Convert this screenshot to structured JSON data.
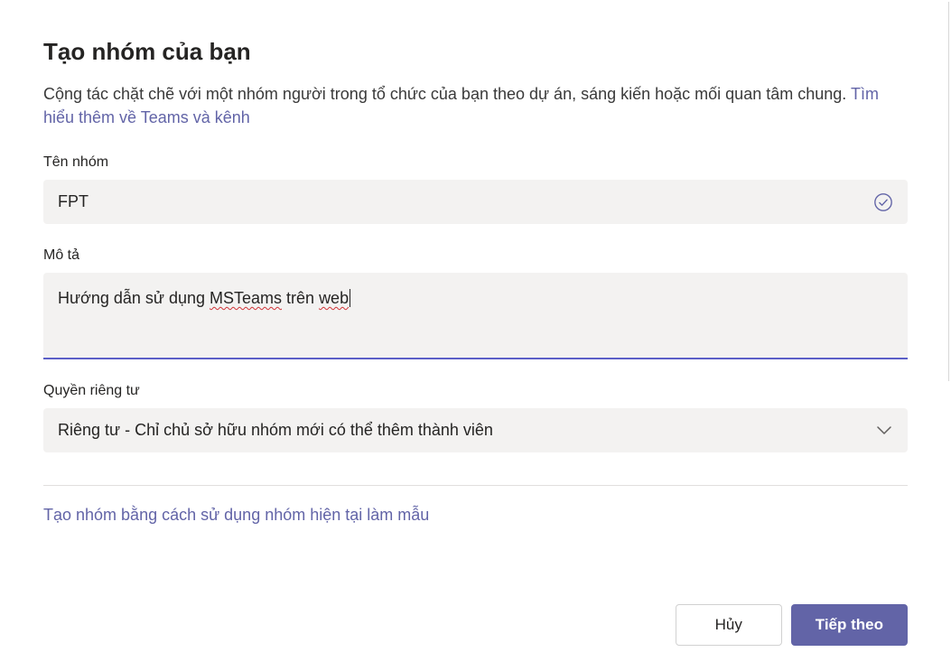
{
  "dialog": {
    "title": "Tạo nhóm của bạn",
    "description_prefix": "Cộng tác chặt chẽ với một nhóm người trong tổ chức của bạn theo dự án, sáng kiến hoặc mối quan tâm chung. ",
    "description_link": "Tìm hiểu thêm về Teams và kênh"
  },
  "fields": {
    "team_name": {
      "label": "Tên nhóm",
      "value": "FPT",
      "valid_icon": "check-circle"
    },
    "description": {
      "label": "Mô tả",
      "value_parts": {
        "p1": "Hướng dẫn sử dụng ",
        "sp1": "MSTeams",
        "p2": " trên ",
        "sp2": "web"
      }
    },
    "privacy": {
      "label": "Quyền riêng tư",
      "selected": "Riêng tư - Chỉ chủ sở hữu nhóm mới có thể thêm thành viên"
    }
  },
  "links": {
    "use_template": "Tạo nhóm bằng cách sử dụng nhóm hiện tại làm mẫu"
  },
  "buttons": {
    "cancel": "Hủy",
    "next": "Tiếp theo"
  },
  "colors": {
    "accent": "#6264A7",
    "input_bg": "#f3f2f1",
    "error_wavy": "#d13438"
  }
}
